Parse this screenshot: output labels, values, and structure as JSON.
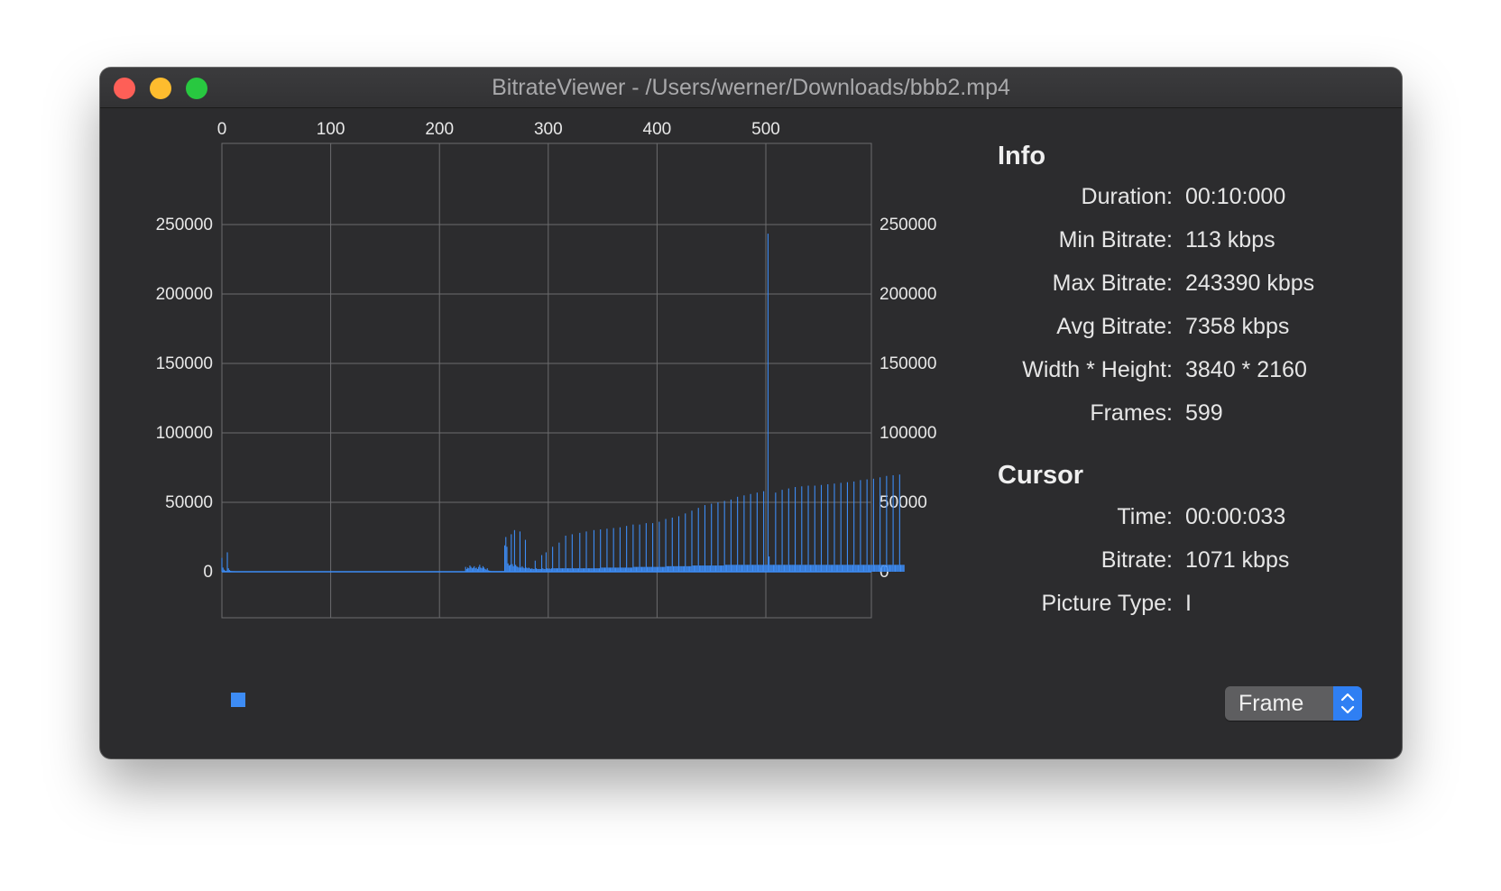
{
  "window": {
    "title": "BitrateViewer - /Users/werner/Downloads/bbb2.mp4"
  },
  "info": {
    "heading": "Info",
    "rows": [
      {
        "label": "Duration:",
        "value": "00:10:000"
      },
      {
        "label": "Min Bitrate:",
        "value": "113 kbps"
      },
      {
        "label": "Max Bitrate:",
        "value": "243390 kbps"
      },
      {
        "label": "Avg Bitrate:",
        "value": "7358 kbps"
      },
      {
        "label": "Width * Height:",
        "value": "3840 * 2160"
      },
      {
        "label": "Frames:",
        "value": "599"
      }
    ]
  },
  "cursor": {
    "heading": "Cursor",
    "rows": [
      {
        "label": "Time:",
        "value": "00:00:033"
      },
      {
        "label": "Bitrate:",
        "value": "1071 kbps"
      },
      {
        "label": "Picture Type:",
        "value": "I"
      }
    ]
  },
  "view_mode": {
    "selected": "Frame"
  },
  "chart_data": {
    "type": "bar",
    "x_ticks": [
      "0",
      "100",
      "200",
      "300",
      "400",
      "500"
    ],
    "y_ticks_left": [
      "250000",
      "200000",
      "150000",
      "100000",
      "50000",
      "0"
    ],
    "y_ticks_right": [
      "250000",
      "200000",
      "150000",
      "100000",
      "50000",
      "0"
    ],
    "xlim": [
      0,
      599
    ],
    "ylim": [
      0,
      250000
    ],
    "grid": true,
    "series_color": "#3d8cf5",
    "values": [
      10000,
      3000,
      1500,
      800,
      600,
      14000,
      2500,
      1200,
      700,
      500,
      400,
      400,
      350,
      350,
      300,
      300,
      300,
      300,
      300,
      300,
      300,
      300,
      300,
      300,
      300,
      300,
      300,
      300,
      300,
      300,
      300,
      300,
      300,
      300,
      300,
      300,
      300,
      300,
      300,
      300,
      300,
      300,
      300,
      300,
      300,
      300,
      300,
      300,
      300,
      300,
      300,
      300,
      300,
      300,
      300,
      300,
      300,
      300,
      300,
      300,
      300,
      300,
      300,
      300,
      300,
      300,
      300,
      300,
      300,
      300,
      300,
      300,
      300,
      300,
      300,
      300,
      300,
      300,
      300,
      300,
      300,
      300,
      300,
      300,
      300,
      300,
      300,
      300,
      300,
      300,
      300,
      300,
      300,
      300,
      300,
      300,
      300,
      300,
      300,
      300,
      300,
      300,
      300,
      300,
      300,
      300,
      300,
      300,
      300,
      300,
      300,
      300,
      300,
      300,
      300,
      300,
      300,
      300,
      300,
      300,
      300,
      300,
      300,
      300,
      300,
      300,
      300,
      300,
      300,
      300,
      300,
      300,
      300,
      300,
      300,
      300,
      300,
      300,
      300,
      300,
      300,
      300,
      300,
      300,
      300,
      300,
      300,
      300,
      300,
      300,
      300,
      300,
      300,
      300,
      300,
      300,
      300,
      300,
      300,
      300,
      300,
      300,
      300,
      300,
      300,
      300,
      300,
      300,
      300,
      300,
      300,
      300,
      300,
      300,
      300,
      300,
      300,
      300,
      300,
      300,
      300,
      300,
      300,
      300,
      300,
      300,
      300,
      300,
      300,
      300,
      300,
      300,
      300,
      300,
      300,
      300,
      300,
      300,
      300,
      300,
      300,
      300,
      300,
      300,
      300,
      300,
      300,
      300,
      300,
      300,
      300,
      300,
      300,
      300,
      300,
      300,
      300,
      300,
      300,
      300,
      300,
      300,
      300,
      300,
      3500,
      2000,
      3000,
      2500,
      4500,
      3500,
      2500,
      3000,
      4000,
      2500,
      3000,
      2000,
      3500,
      5000,
      3000,
      2500,
      4000,
      3000,
      2000,
      1500,
      2500,
      1000,
      800,
      600,
      500,
      500,
      500,
      500,
      500,
      500,
      500,
      500,
      500,
      500,
      500,
      500,
      19000,
      25000,
      18000,
      6000,
      4500,
      5000,
      27000,
      5500,
      4000,
      30000,
      5000,
      4000,
      3500,
      3000,
      29000,
      3000,
      4000,
      3000,
      2500,
      23000,
      3000,
      2500,
      3000,
      2500,
      2000,
      2500,
      2000,
      2000,
      8000,
      2500,
      2000,
      2000,
      2000,
      2000,
      12000,
      2500,
      2000,
      2000,
      14000,
      2500,
      2000,
      2500,
      2000,
      2500,
      18000,
      2500,
      2500,
      2500,
      2500,
      2500,
      21000,
      2500,
      2500,
      2500,
      2500,
      2500,
      26000,
      2500,
      2500,
      2500,
      2500,
      2500,
      27000,
      2500,
      2500,
      2500,
      2500,
      2500,
      2500,
      28000,
      2500,
      2500,
      2500,
      2500,
      2500,
      29000,
      2500,
      2500,
      2500,
      2500,
      2500,
      2500,
      30000,
      2500,
      2500,
      2500,
      2500,
      2500,
      30500,
      3000,
      3000,
      3000,
      3000,
      3000,
      31000,
      3000,
      3000,
      3000,
      3000,
      3000,
      31500,
      3000,
      3000,
      3000,
      3000,
      3000,
      32000,
      3000,
      3000,
      3000,
      3000,
      3000,
      33000,
      3000,
      3000,
      3000,
      3000,
      3000,
      34000,
      3500,
      3500,
      3500,
      3500,
      3500,
      34000,
      3500,
      3500,
      3500,
      3500,
      3500,
      35000,
      3500,
      3500,
      3500,
      3500,
      3500,
      35000,
      3500,
      3500,
      3500,
      3500,
      3500,
      36000,
      3500,
      3500,
      3500,
      3500,
      3500,
      38000,
      4000,
      4000,
      4000,
      4000,
      4000,
      39000,
      4000,
      4000,
      4000,
      4000,
      4000,
      40000,
      4000,
      4000,
      4000,
      4000,
      4000,
      42000,
      4000,
      4000,
      4000,
      4000,
      4000,
      44000,
      4500,
      4500,
      4500,
      4500,
      4500,
      46000,
      4500,
      4500,
      4500,
      4500,
      4500,
      48000,
      4500,
      4500,
      4500,
      4500,
      4500,
      49000,
      4500,
      4500,
      4500,
      4500,
      4500,
      50000,
      4500,
      4500,
      4500,
      4500,
      4500,
      51000,
      5000,
      5000,
      5000,
      5000,
      5000,
      52000,
      5000,
      5000,
      5000,
      5000,
      5000,
      54000,
      5000,
      5000,
      5000,
      5000,
      5000,
      55000,
      5000,
      5000,
      5000,
      5000,
      5000,
      56000,
      5000,
      5000,
      5000,
      5000,
      5000,
      57000,
      5000,
      5000,
      5000,
      5000,
      5000,
      58000,
      5000,
      5000,
      5000,
      243390,
      11000,
      5000,
      5000,
      5000,
      5000,
      5000,
      57000,
      5000,
      5000,
      5000,
      5000,
      5000,
      59000,
      5000,
      5000,
      5000,
      5000,
      5000,
      60000,
      5000,
      5000,
      5000,
      5000,
      5000,
      61000,
      5000,
      5000,
      5000,
      5000,
      5000,
      61500,
      5000,
      5000,
      5000,
      5000,
      5000,
      62000,
      5000,
      5000,
      5000,
      5000,
      5000,
      62000,
      5000,
      5000,
      5000,
      5000,
      5000,
      62500,
      5000,
      5000,
      5000,
      5000,
      5000,
      63000,
      5000,
      5000,
      5000,
      5000,
      5000,
      63500,
      5000,
      5000,
      5000,
      5000,
      5000,
      64000,
      5000,
      5000,
      5000,
      5000,
      5000,
      64500,
      5000,
      5000,
      5000,
      5000,
      5000,
      65000,
      5000,
      5000,
      5000,
      5000,
      5000,
      66000,
      5000,
      5000,
      5000,
      5000,
      5000,
      66500,
      5000,
      5000,
      5000,
      5000,
      5000,
      67000,
      5000,
      5000,
      5000,
      5000,
      5000,
      68000,
      5000,
      5000,
      5000,
      5000,
      5000,
      69000,
      5000,
      5000,
      5000,
      5000,
      5000,
      69500,
      5000,
      5000,
      5000,
      5000,
      5000,
      70000,
      5000,
      5000,
      5000,
      5000
    ]
  }
}
